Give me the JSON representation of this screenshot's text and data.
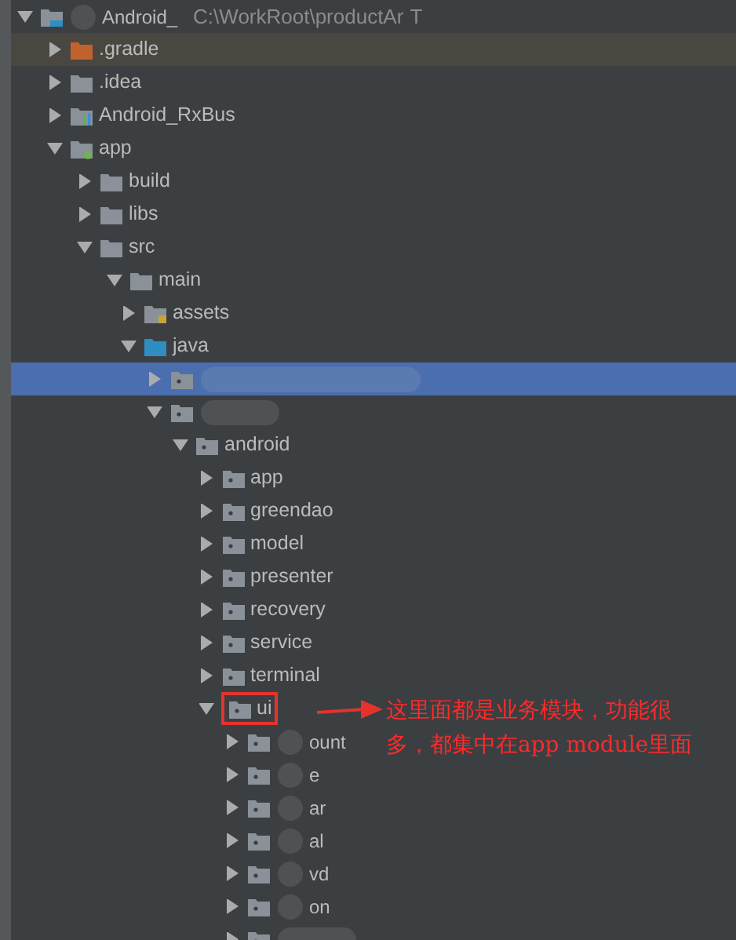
{
  "tree": [
    {
      "label": "Android_",
      "path": "C:\\WorkRoot\\productAr",
      "tail": "T",
      "kind": "project",
      "redacted": true,
      "expanded": true,
      "selected": false,
      "children": [
        {
          "label": ".gradle",
          "kind": "excluded",
          "expanded": false,
          "selected": false,
          "hover": true
        },
        {
          "label": ".idea",
          "kind": "folder",
          "expanded": false,
          "selected": false
        },
        {
          "label": "Android_RxBus",
          "kind": "module",
          "expanded": false,
          "selected": false
        },
        {
          "label": "app",
          "kind": "app",
          "expanded": true,
          "selected": false,
          "children": [
            {
              "label": "build",
              "kind": "folder",
              "expanded": false,
              "selected": false
            },
            {
              "label": "libs",
              "kind": "folder",
              "expanded": false,
              "selected": false
            },
            {
              "label": "src",
              "kind": "folder",
              "expanded": true,
              "selected": false,
              "children": [
                {
                  "label": "main",
                  "kind": "folder",
                  "expanded": true,
                  "selected": false,
                  "children": [
                    {
                      "label": "assets",
                      "kind": "resource",
                      "expanded": false,
                      "selected": false
                    },
                    {
                      "label": "java",
                      "kind": "source",
                      "expanded": true,
                      "selected": false,
                      "children": [
                        {
                          "kind": "package",
                          "redacted": true,
                          "expanded": false,
                          "selected": true
                        },
                        {
                          "kind": "package",
                          "redacted": true,
                          "expanded": true,
                          "selected": false,
                          "children": [
                            {
                              "label": "android",
                              "kind": "package",
                              "expanded": true,
                              "selected": false,
                              "children": [
                                {
                                  "label": "app",
                                  "kind": "package",
                                  "expanded": false,
                                  "selected": false
                                },
                                {
                                  "label": "greendao",
                                  "kind": "package",
                                  "expanded": false,
                                  "selected": false
                                },
                                {
                                  "label": "model",
                                  "kind": "package",
                                  "expanded": false,
                                  "selected": false
                                },
                                {
                                  "label": "presenter",
                                  "kind": "package",
                                  "expanded": false,
                                  "selected": false
                                },
                                {
                                  "label": "recovery",
                                  "kind": "package",
                                  "expanded": false,
                                  "selected": false
                                },
                                {
                                  "label": "service",
                                  "kind": "package",
                                  "expanded": false,
                                  "selected": false
                                },
                                {
                                  "label": "terminal",
                                  "kind": "package",
                                  "expanded": false,
                                  "selected": false
                                },
                                {
                                  "label": "ui",
                                  "kind": "package",
                                  "boxed": true,
                                  "expanded": true,
                                  "selected": false,
                                  "children": [
                                    {
                                      "label": "ount",
                                      "kind": "package",
                                      "redacted": true,
                                      "expanded": false,
                                      "selected": false
                                    },
                                    {
                                      "label": "e",
                                      "kind": "package",
                                      "redacted": true,
                                      "expanded": false,
                                      "selected": false
                                    },
                                    {
                                      "label": "ar",
                                      "kind": "package",
                                      "redacted": true,
                                      "expanded": false,
                                      "selected": false
                                    },
                                    {
                                      "label": "al",
                                      "kind": "package",
                                      "redacted": true,
                                      "expanded": false,
                                      "selected": false
                                    },
                                    {
                                      "label": "vd",
                                      "kind": "package",
                                      "redacted": true,
                                      "expanded": false,
                                      "selected": false
                                    },
                                    {
                                      "label": "on",
                                      "kind": "package",
                                      "redacted": true,
                                      "expanded": false,
                                      "selected": false
                                    },
                                    {
                                      "kind": "package",
                                      "redacted": true,
                                      "expanded": false,
                                      "selected": false
                                    }
                                  ]
                                }
                              ]
                            }
                          ]
                        }
                      ]
                    }
                  ]
                }
              ]
            }
          ]
        }
      ]
    }
  ],
  "annotation": {
    "lines": [
      "这里面都是业务模块，功能很",
      "多，都集中在app module里面"
    ]
  }
}
